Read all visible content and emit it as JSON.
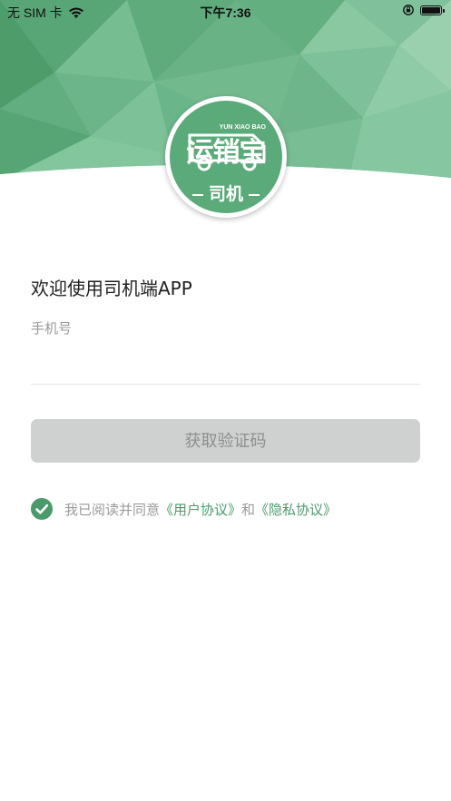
{
  "status_bar": {
    "carrier": "无 SIM 卡",
    "time": "下午7:36",
    "icons": [
      "wifi-icon",
      "orientation-lock-icon",
      "battery-icon"
    ]
  },
  "logo": {
    "brand": "运销宝",
    "brand_en": "YUN XIAO BAO",
    "role": "司机"
  },
  "login": {
    "welcome": "欢迎使用司机端APP",
    "phone_label": "手机号",
    "phone_value": "",
    "get_code_button": "获取验证码"
  },
  "agreement": {
    "checked": true,
    "prefix": "我已阅读并同意",
    "user_agreement": "《用户协议》",
    "connector": "和",
    "privacy_agreement": "《隐私协议》"
  },
  "colors": {
    "brand_green": "#5aaa7a",
    "link_green": "#4a9a6a",
    "button_disabled": "#cfd1d0",
    "label_gray": "#9a9a9a"
  }
}
